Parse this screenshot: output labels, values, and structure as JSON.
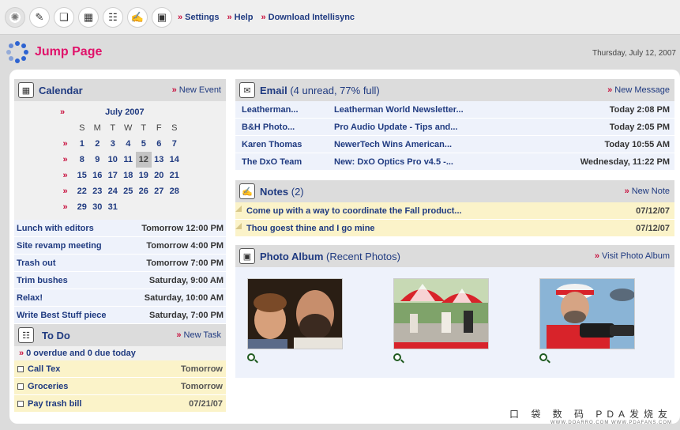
{
  "toolbar": {
    "links": [
      "Settings",
      "Help",
      "Download Intellisync"
    ]
  },
  "header": {
    "title": "Jump Page",
    "date": "Thursday, July 12, 2007"
  },
  "calendar": {
    "title": "Calendar",
    "new_event": "New Event",
    "month": "July 2007",
    "dows": [
      "S",
      "M",
      "T",
      "W",
      "T",
      "F",
      "S"
    ],
    "weeks": [
      [
        "1",
        "2",
        "3",
        "4",
        "5",
        "6",
        "7"
      ],
      [
        "8",
        "9",
        "10",
        "11",
        "12",
        "13",
        "14"
      ],
      [
        "15",
        "16",
        "17",
        "18",
        "19",
        "20",
        "21"
      ],
      [
        "22",
        "23",
        "24",
        "25",
        "26",
        "27",
        "28"
      ],
      [
        "29",
        "30",
        "31",
        "",
        "",
        "",
        ""
      ]
    ],
    "today": "12",
    "events": [
      {
        "name": "Lunch with editors",
        "time": "Tomorrow 12:00 PM"
      },
      {
        "name": "Site revamp meeting",
        "time": "Tomorrow 4:00 PM"
      },
      {
        "name": "Trash out",
        "time": "Tomorrow 7:00 PM"
      },
      {
        "name": "Trim bushes",
        "time": "Saturday, 9:00 AM"
      },
      {
        "name": "Relax!",
        "time": "Saturday, 10:00 AM"
      },
      {
        "name": "Write Best Stuff piece",
        "time": "Saturday, 7:00 PM"
      }
    ]
  },
  "todo": {
    "title": "To Do",
    "new_task": "New Task",
    "overdue": "0 overdue and 0 due today",
    "tasks": [
      {
        "name": "Call Tex",
        "due": "Tomorrow"
      },
      {
        "name": "Groceries",
        "due": "Tomorrow"
      },
      {
        "name": "Pay trash bill",
        "due": "07/21/07"
      }
    ]
  },
  "email": {
    "title": "Email",
    "subtitle": "(4 unread, 77% full)",
    "new_message": "New Message",
    "rows": [
      {
        "from": "Leatherman...",
        "subject": "Leatherman World Newsletter...",
        "when": "Today 2:08 PM"
      },
      {
        "from": "B&H Photo...",
        "subject": "Pro Audio Update - Tips and...",
        "when": "Today 2:05 PM"
      },
      {
        "from": "Karen Thomas",
        "subject": "NewerTech Wins American...",
        "when": "Today 10:55 AM"
      },
      {
        "from": "The DxO Team",
        "subject": "New: DxO Optics Pro v4.5 -...",
        "when": "Wednesday, 11:22 PM"
      }
    ]
  },
  "notes": {
    "title": "Notes",
    "subtitle": "(2)",
    "new_note": "New Note",
    "rows": [
      {
        "text": "Come up with a way to coordinate the Fall product...",
        "date": "07/12/07"
      },
      {
        "text": "Thou goest thine and I go mine",
        "date": "07/12/07"
      }
    ]
  },
  "photos": {
    "title": "Photo Album",
    "subtitle": "(Recent Photos)",
    "visit": "Visit Photo Album"
  },
  "watermark": {
    "line1": "口 袋 数 码   PDA发烧友",
    "line2": "WWW.DOARRO.COM    WWW.PDAFANS.COM"
  }
}
